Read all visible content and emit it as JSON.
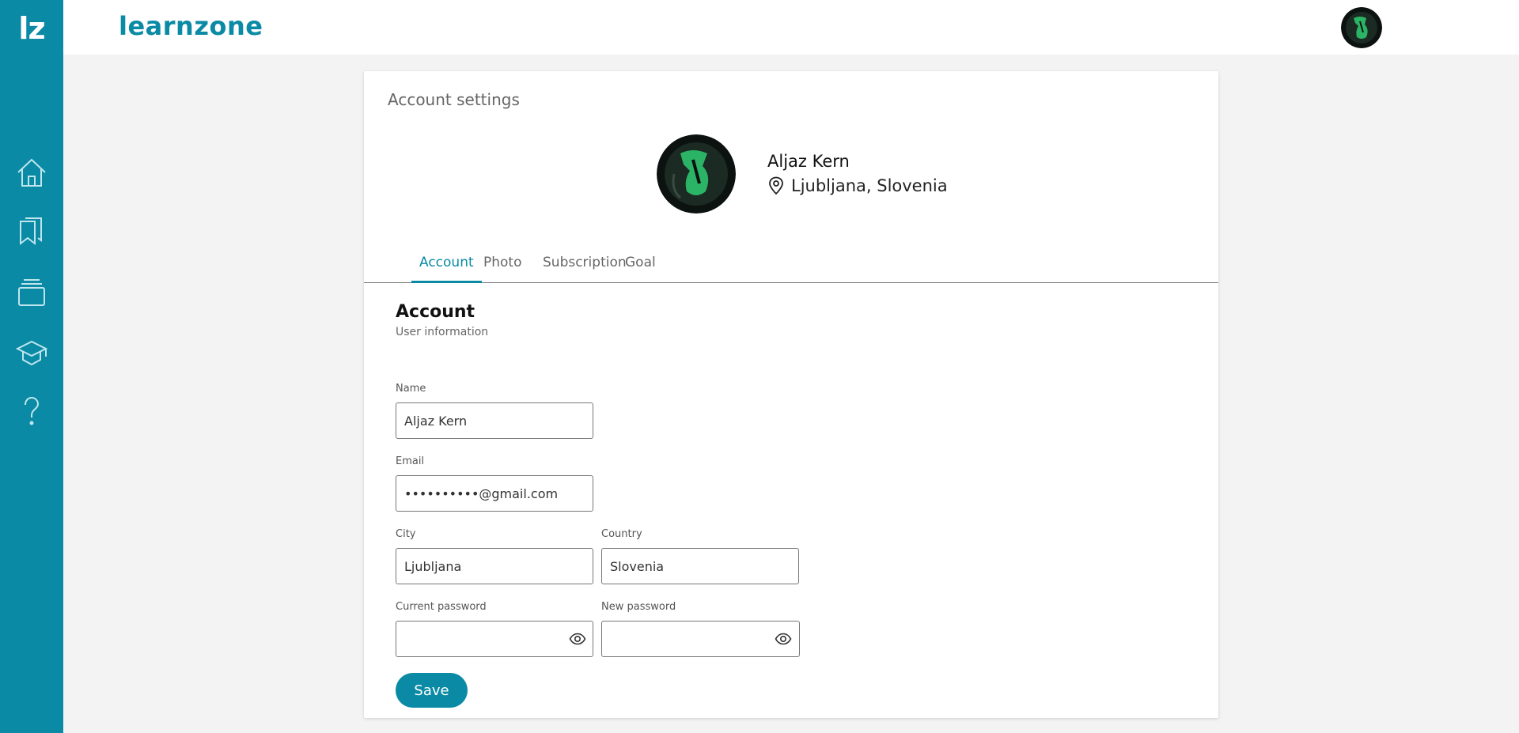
{
  "sidebar": {
    "logo": "lz",
    "items": [
      {
        "icon": "home-icon"
      },
      {
        "icon": "bookmarks-icon"
      },
      {
        "icon": "layers-icon"
      },
      {
        "icon": "graduation-cap-icon"
      },
      {
        "icon": "help-icon"
      }
    ]
  },
  "header": {
    "brand": "learnzone"
  },
  "page": {
    "title": "Account settings",
    "profile": {
      "name": "Aljaz Kern",
      "location": "Ljubljana, Slovenia"
    },
    "tabs": [
      {
        "label": "Account",
        "active": true
      },
      {
        "label": "Photo",
        "active": false
      },
      {
        "label": "Subscription",
        "active": false
      },
      {
        "label": "Goal",
        "active": false
      }
    ],
    "section": {
      "title": "Account",
      "subtitle": "User information"
    },
    "form": {
      "name_label": "Name",
      "name_value": "Aljaz Kern",
      "email_label": "Email",
      "email_value": "••••••••••@gmail.com",
      "city_label": "City",
      "city_value": "Ljubljana",
      "country_label": "Country",
      "country_value": "Slovenia",
      "current_password_label": "Current password",
      "current_password_value": "",
      "new_password_label": "New password",
      "new_password_value": "",
      "save_label": "Save"
    }
  },
  "colors": {
    "accent": "#0a8aa4",
    "background": "#f3f3f3"
  }
}
